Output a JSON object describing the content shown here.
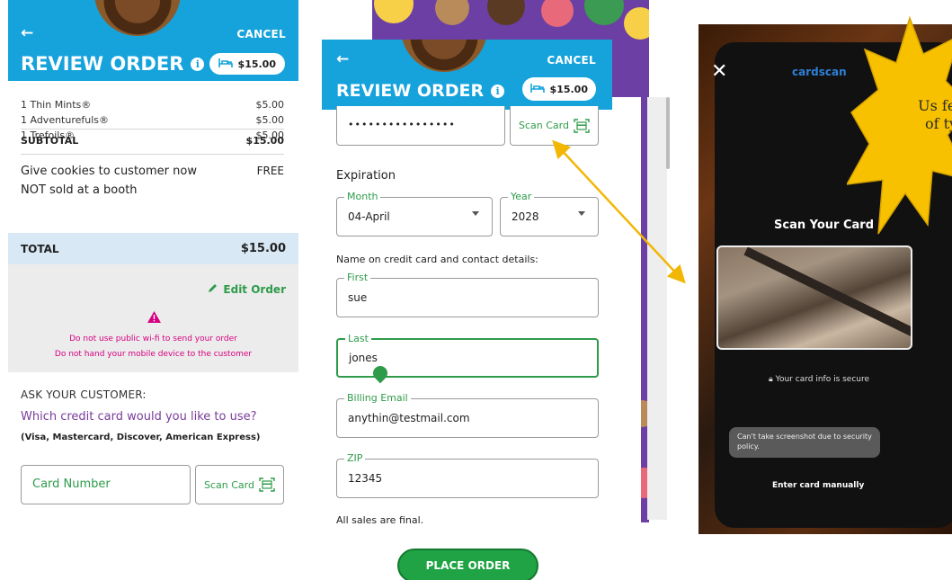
{
  "panel1": {
    "cancel": "CANCEL",
    "title": "REVIEW ORDER",
    "cart_total": "$15.00",
    "items": [
      {
        "name": "1 Thin Mints®",
        "price": "$5.00"
      },
      {
        "name": "1 Adventurefuls®",
        "price": "$5.00"
      },
      {
        "name": "1 Trefoils®",
        "price": "$5.00"
      }
    ],
    "subtotal_label": "SUBTOTAL",
    "subtotal_value": "$15.00",
    "give_cookies": "Give cookies to customer now",
    "give_free": "FREE",
    "not_sold": "NOT sold at a booth",
    "total_label": "TOTAL",
    "total_value": "$15.00",
    "edit_order": "Edit Order",
    "warning_1": "Do not use public wi-fi to send your order",
    "warning_2": "Do not hand your mobile device to the customer",
    "ask_customer": "ASK YOUR CUSTOMER:",
    "which_card": "Which credit card would you like to use?",
    "card_types": "(Visa, Mastercard, Discover, American Express)",
    "card_number_placeholder": "Card Number",
    "scan_card": "Scan Card"
  },
  "panel2": {
    "cancel": "CANCEL",
    "title": "REVIEW ORDER",
    "cart_total": "$15.00",
    "card_number_value": "••••••••••••••••",
    "scan_card": "Scan Card",
    "expiration_label": "Expiration",
    "month_label": "Month",
    "month_value": "04-April",
    "year_label": "Year",
    "year_value": "2028",
    "name_contact_label": "Name on credit card and contact details:",
    "first_label": "First",
    "first_value": "sue",
    "last_label": "Last",
    "last_value": "jones",
    "email_label": "Billing Email",
    "email_value": "anythin@testmail.com",
    "zip_label": "ZIP",
    "zip_value": "12345",
    "all_sales_final": "All sales are final.",
    "place_order": "PLACE ORDER"
  },
  "panel3": {
    "brand": "cardscan",
    "scan_title": "Scan Your Card",
    "secure_note": "Your card info is secure",
    "toast": "Can't take screenshot due to security policy.",
    "enter_manually": "Enter card manually",
    "callout_text": "Us fea of ty"
  },
  "colors": {
    "header_blue": "#16a3dc",
    "action_green": "#2e9b4a",
    "warning_magenta": "#d7007f",
    "question_purple": "#7a3b9c",
    "total_bar": "#d8e8f5",
    "starburst": "#f8c100",
    "arrow": "#f2b705"
  },
  "icons": {
    "back": "arrow-left-icon",
    "info": "info-icon",
    "cart": "cart-icon",
    "edit": "pencil-icon",
    "warning": "warning-triangle-icon",
    "scan": "scan-card-icon",
    "close": "close-icon",
    "lock": "lock-icon"
  }
}
